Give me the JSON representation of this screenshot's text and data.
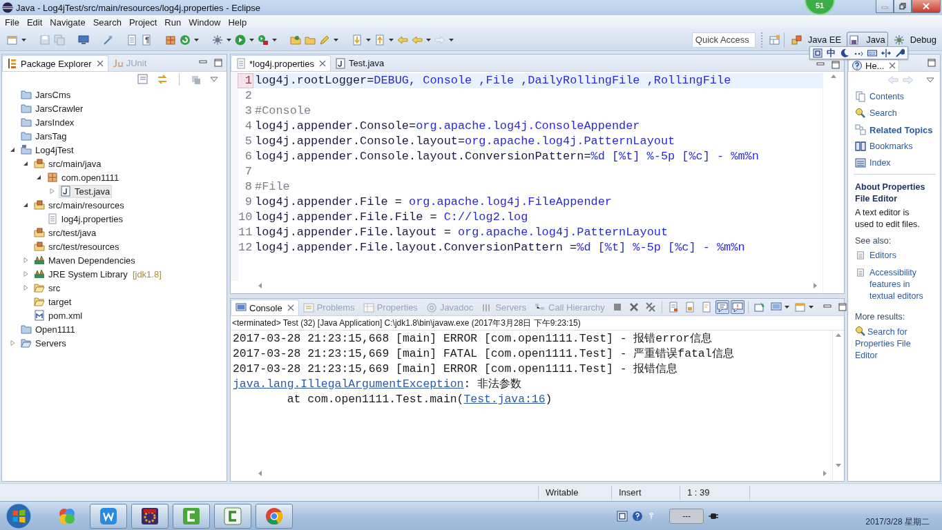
{
  "window": {
    "title": "Java - Log4jTest/src/main/resources/log4j.properties - Eclipse"
  },
  "floating_ball": {
    "count": "51"
  },
  "menu": [
    "File",
    "Edit",
    "Navigate",
    "Search",
    "Project",
    "Run",
    "Window",
    "Help"
  ],
  "quick_access": {
    "placeholder": "Quick Access"
  },
  "perspectives": [
    {
      "label": "Java EE",
      "selected": false
    },
    {
      "label": "Java",
      "selected": true
    },
    {
      "label": "Debug",
      "selected": false
    }
  ],
  "ime_toolbar": {
    "mode": "中"
  },
  "package_explorer": {
    "tabs": [
      {
        "label": "Package Explorer",
        "selected": true
      },
      {
        "label": "JUnit",
        "selected": false
      }
    ],
    "tree": [
      {
        "label": "JarsCms",
        "kind": "project",
        "selected": false
      },
      {
        "label": "JarsCrawler",
        "kind": "project",
        "selected": false
      },
      {
        "label": "JarsIndex",
        "kind": "project",
        "selected": false
      },
      {
        "label": "JarsTag",
        "kind": "project",
        "selected": false
      },
      {
        "label": "Log4jTest",
        "kind": "maven-project",
        "expanded": true,
        "selected": false,
        "children": [
          {
            "label": "src/main/java",
            "kind": "source-folder",
            "expanded": true,
            "selected": false,
            "children": [
              {
                "label": "com.open1111",
                "kind": "package",
                "expanded": true,
                "selected": false,
                "children": [
                  {
                    "label": "Test.java",
                    "kind": "java-file",
                    "expanded": false,
                    "selected": true
                  }
                ]
              }
            ]
          },
          {
            "label": "src/main/resources",
            "kind": "source-folder",
            "expanded": true,
            "selected": false,
            "children": [
              {
                "label": "log4j.properties",
                "kind": "text-file",
                "selected": false
              }
            ]
          },
          {
            "label": "src/test/java",
            "kind": "source-folder",
            "selected": false
          },
          {
            "label": "src/test/resources",
            "kind": "source-folder",
            "selected": false
          },
          {
            "label": "Maven Dependencies",
            "kind": "library",
            "expanded": false,
            "selected": false
          },
          {
            "label": "JRE System Library",
            "decoration": "[jdk1.8]",
            "kind": "library",
            "expanded": false,
            "selected": false
          },
          {
            "label": "src",
            "kind": "folder",
            "expanded": false,
            "selected": false
          },
          {
            "label": "target",
            "kind": "folder",
            "selected": false
          },
          {
            "label": "pom.xml",
            "kind": "xml-file",
            "selected": false
          }
        ]
      },
      {
        "label": "Open1111",
        "kind": "project",
        "selected": false
      },
      {
        "label": "Servers",
        "kind": "open-project",
        "expanded": false,
        "selected": false
      }
    ]
  },
  "editor": {
    "tabs": [
      {
        "label": "*log4j.properties",
        "selected": true
      },
      {
        "label": "Test.java",
        "selected": false
      }
    ],
    "lines": [
      {
        "number": "1",
        "current": true,
        "kind": "property",
        "key": "log4j.rootLogger=",
        "value": "DEBUG, Console ,File ,DailyRollingFile ,RollingFile"
      },
      {
        "number": "2",
        "current": false,
        "kind": "blank"
      },
      {
        "number": "3",
        "current": false,
        "kind": "comment",
        "text": "#Console"
      },
      {
        "number": "4",
        "current": false,
        "kind": "property",
        "key": "log4j.appender.Console=",
        "value": "org.apache.log4j.ConsoleAppender"
      },
      {
        "number": "5",
        "current": false,
        "kind": "property",
        "key": "log4j.appender.Console.layout=",
        "value": "org.apache.log4j.PatternLayout"
      },
      {
        "number": "6",
        "current": false,
        "kind": "property",
        "key": "log4j.appender.Console.layout.ConversionPattern=",
        "value": "%d [%t] %-5p [%c] - %m%n"
      },
      {
        "number": "7",
        "current": false,
        "kind": "blank"
      },
      {
        "number": "8",
        "current": false,
        "kind": "comment",
        "text": "#File"
      },
      {
        "number": "9",
        "current": false,
        "kind": "property",
        "key": "log4j.appender.File = ",
        "value": "org.apache.log4j.FileAppender"
      },
      {
        "number": "10",
        "current": false,
        "kind": "property",
        "key": "log4j.appender.File.File = ",
        "value": "C://log2.log"
      },
      {
        "number": "11",
        "current": false,
        "kind": "property",
        "key": "log4j.appender.File.layout = ",
        "value": "org.apache.log4j.PatternLayout"
      },
      {
        "number": "12",
        "current": false,
        "kind": "property",
        "key": "log4j.appender.File.layout.ConversionPattern =",
        "value": "%d [%t] %-5p [%c] - %m%n"
      }
    ]
  },
  "console": {
    "tabs": [
      {
        "label": "Console",
        "selected": true
      },
      {
        "label": "Problems",
        "selected": false
      },
      {
        "label": "Properties",
        "selected": false
      },
      {
        "label": "Javadoc",
        "selected": false
      },
      {
        "label": "Servers",
        "selected": false
      },
      {
        "label": "Call Hierarchy",
        "selected": false
      }
    ],
    "toggles": [
      {
        "on": true
      },
      {
        "on": true
      }
    ],
    "header": "<terminated> Test (32) [Java Application] C:\\jdk1.8\\bin\\javaw.exe (2017年3月28日 下午9:23:15)",
    "lines": [
      {
        "parts": [
          {
            "text": "2017-03-28 21:23:15,668 [main] ERROR [com.open1111.Test] - 报错error信息",
            "link": false
          }
        ]
      },
      {
        "parts": [
          {
            "text": "2017-03-28 21:23:15,669 [main] FATAL [com.open1111.Test] - 严重错误fatal信息",
            "link": false
          }
        ]
      },
      {
        "parts": [
          {
            "text": "2017-03-28 21:23:15,669 [main] ERROR [com.open1111.Test] - 报错信息",
            "link": false
          }
        ]
      },
      {
        "parts": [
          {
            "text": "java.lang.IllegalArgumentException",
            "link": true
          },
          {
            "text": ": 非法参数",
            "link": false
          }
        ]
      },
      {
        "parts": [
          {
            "text": "\tat com.open1111.Test.main(",
            "link": false
          },
          {
            "text": "Test.java:16",
            "link": true
          },
          {
            "text": ")",
            "link": false
          }
        ]
      }
    ]
  },
  "help": {
    "tab": "He...",
    "nav": [
      {
        "label": "Contents",
        "selected": false
      },
      {
        "label": "Search",
        "selected": false
      },
      {
        "label": "Related Topics",
        "selected": true
      },
      {
        "label": "Bookmarks",
        "selected": false
      },
      {
        "label": "Index",
        "selected": false
      }
    ],
    "heading": "About Properties File Editor",
    "description": "A text editor is used to edit files.",
    "see_also_label": "See also:",
    "see_also": [
      "Editors",
      "Accessibility features in textual editors"
    ],
    "more_label": "More results:",
    "more": [
      "Search for Properties File Editor"
    ]
  },
  "status_bar": {
    "state": "Writable",
    "mode": "Insert",
    "position": "1 : 39"
  },
  "taskbar": {
    "apps": [
      {
        "running": false
      },
      {
        "running": true
      },
      {
        "running": true
      },
      {
        "running": true
      },
      {
        "running": true
      },
      {
        "running": true
      }
    ],
    "tray_box": "---",
    "date": "2017/3/28 星期二"
  }
}
